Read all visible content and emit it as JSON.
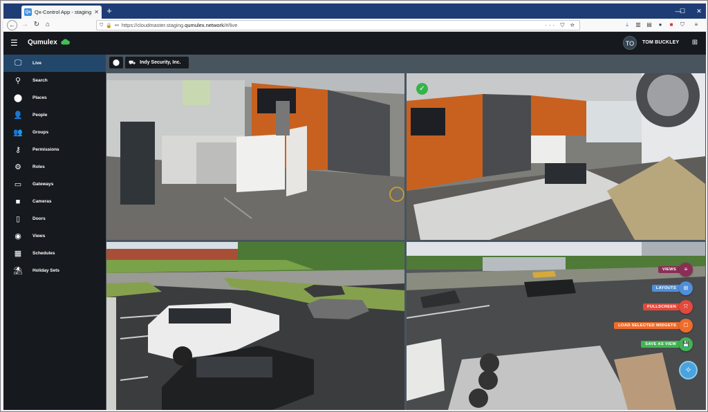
{
  "browser": {
    "tab_title": "Qx-Control App - staging",
    "favicon_text": "Qx",
    "url_prefix": "https://cloudmaster.staging.",
    "url_domain": "qumulex.network",
    "url_suffix": "/#/live",
    "url_actions": "··· ⛉ ☆",
    "win_min": "—",
    "win_max": "☐",
    "win_close": "✕"
  },
  "app": {
    "brand": "Qumulex",
    "avatar_initials": "TO",
    "username": "TOM BUCKLEY"
  },
  "sidebar": {
    "items": [
      {
        "label": "Live",
        "icon": "monitor-icon",
        "glyph": "🖵"
      },
      {
        "label": "Search",
        "icon": "search-icon",
        "glyph": "⚲"
      },
      {
        "label": "Places",
        "icon": "map-pin-icon",
        "glyph": "⬤"
      },
      {
        "label": "People",
        "icon": "person-icon",
        "glyph": "👤"
      },
      {
        "label": "Groups",
        "icon": "group-icon",
        "glyph": "👥"
      },
      {
        "label": "Permissions",
        "icon": "key-icon",
        "glyph": "⚷"
      },
      {
        "label": "Roles",
        "icon": "user-cog-icon",
        "glyph": "⚙"
      },
      {
        "label": "Gateways",
        "icon": "hdd-icon",
        "glyph": "▭"
      },
      {
        "label": "Cameras",
        "icon": "video-icon",
        "glyph": "■"
      },
      {
        "label": "Doors",
        "icon": "door-icon",
        "glyph": "▯"
      },
      {
        "label": "Views",
        "icon": "eye-icon",
        "glyph": "◉"
      },
      {
        "label": "Schedules",
        "icon": "calendar-icon",
        "glyph": "▦"
      },
      {
        "label": "Holiday Sets",
        "icon": "umbrella-beach-icon",
        "glyph": "⛱"
      }
    ]
  },
  "toolbar": {
    "org_label": "Indy Security, Inc."
  },
  "fab_menu": [
    {
      "label": "VIEWS",
      "color": "#8b2e57",
      "glyph": "≡"
    },
    {
      "label": "LAYOUTS",
      "color": "#4f8fd9",
      "glyph": "⊞"
    },
    {
      "label": "FULLSCREEN",
      "color": "#e24a3c",
      "glyph": "⤧"
    },
    {
      "label": "LOAD SELECTED WIDGETS",
      "color": "#ef6c2b",
      "glyph": "☐"
    },
    {
      "label": "SAVE AS VIEW",
      "color": "#3fb653",
      "glyph": "💾"
    }
  ],
  "colors": {
    "header_bg": "#16191d",
    "active_item": "#22476a",
    "content_bg": "#48555f",
    "accent_green": "#36b34a"
  }
}
